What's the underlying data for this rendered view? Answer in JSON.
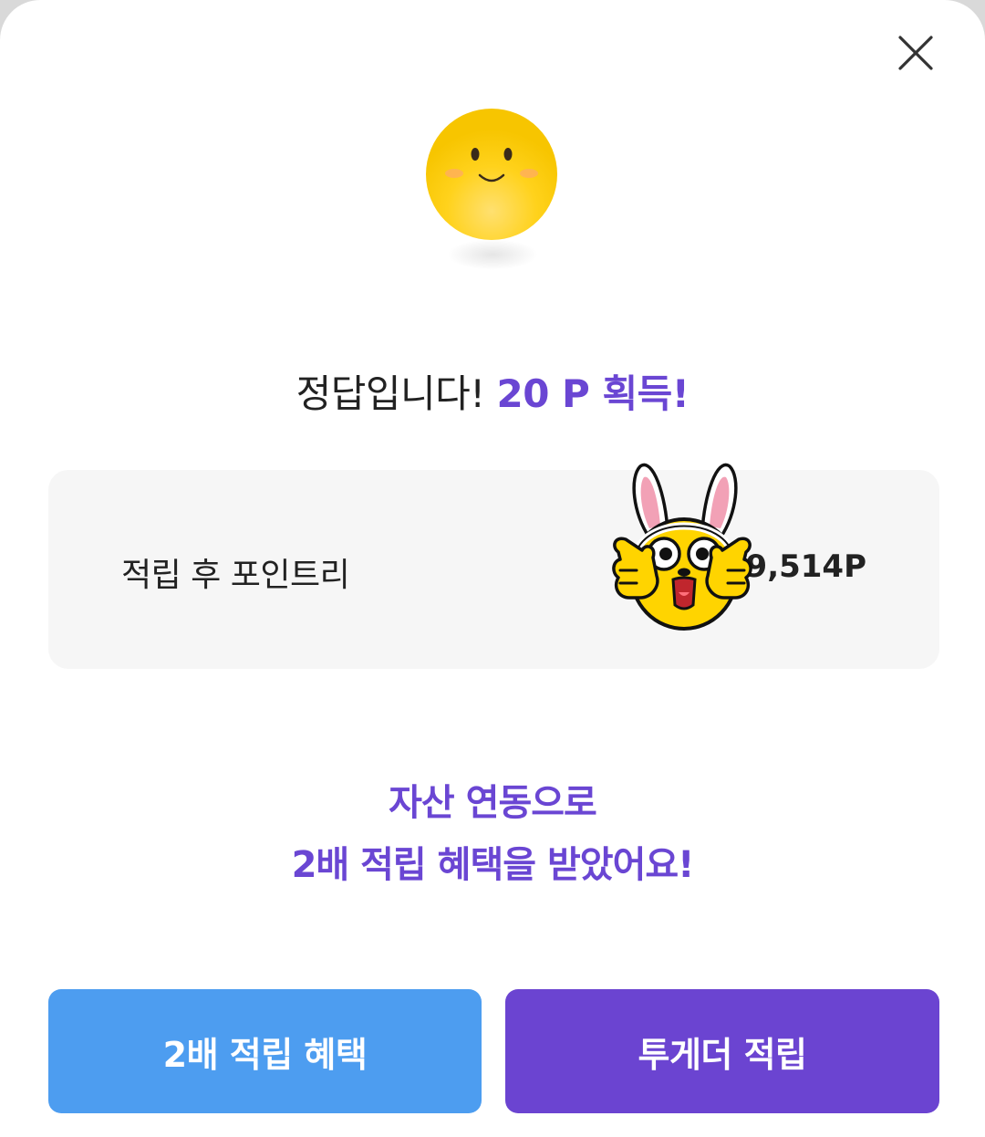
{
  "result": {
    "prefix": "정답입니다! ",
    "reward": "20 P 획득!"
  },
  "points_card": {
    "label": "적립 후 포인트리",
    "value": "9,514P"
  },
  "benefit": {
    "line1": "자산 연동으로",
    "line2": "2배 적립 혜택을 받았어요!"
  },
  "buttons": {
    "double_reward_label": "2배 적립 혜택",
    "together_reward_label": "투게더 적립"
  },
  "icons": {
    "close": "close-icon",
    "emoji": "smiley-emoji-icon",
    "sticker": "bunny-ear-character-sticker"
  },
  "colors": {
    "accent_purple": "#6a46d3",
    "button_blue": "#4d9df0",
    "button_purple": "#6b44d1",
    "card_bg": "#f6f6f6"
  }
}
